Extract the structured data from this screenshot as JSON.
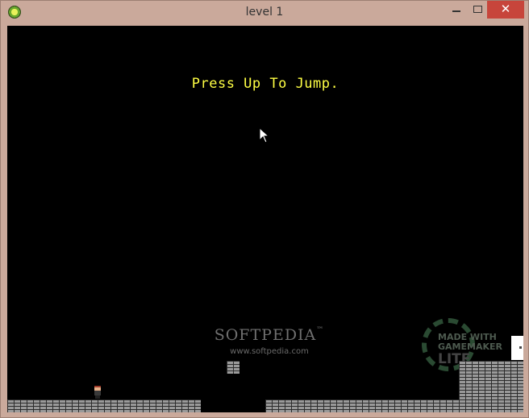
{
  "window": {
    "title": "level 1",
    "close_glyph": "✕",
    "controls": [
      "minimize-icon",
      "maximize-icon",
      "close-icon"
    ]
  },
  "game": {
    "hint_text": "Press Up To Jump.",
    "background_color": "#000000",
    "hint_color": "#ffff44"
  },
  "watermark": {
    "name": "SOFTPEDIA",
    "trademark": "™",
    "url": "www.softpedia.com"
  },
  "badge": {
    "line1": "MADE WITH",
    "line2": "GAMEMAKER",
    "line3": "LITE"
  },
  "icons": {
    "app": "gamemaker-icon",
    "cursor": "mouse-cursor-icon"
  }
}
